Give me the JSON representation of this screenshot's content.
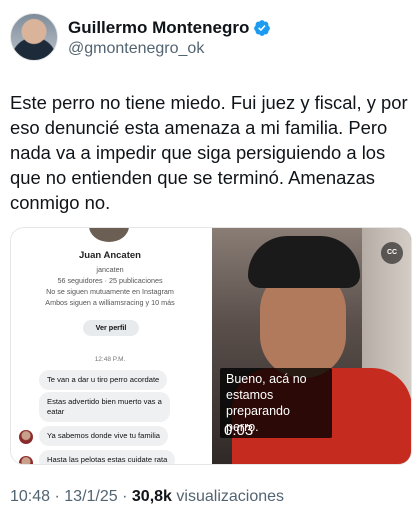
{
  "author": {
    "name": "Guillermo Montenegro",
    "handle": "@gmontenegro_ok",
    "verified_color": "#1d9bf0"
  },
  "tweet": {
    "text": "Este perro no tiene miedo. Fui juez y fiscal, y por eso denuncié esta amenaza a mi familia. Pero nada va a impedir que siga persiguiendo a los que no entienden que se terminó. Amenazas conmigo no."
  },
  "dm_screenshot": {
    "profile_name": "Juan Ancaten",
    "username": "jancaten",
    "stats": "56 seguidores · 25 publicaciones",
    "mutual_note": "No se siguen mutuamente en Instagram",
    "followers_note": "Ambos siguen a williamsracing y 10 más",
    "view_profile": "Ver perfil",
    "time": "12:48 P.M.",
    "messages": [
      "Te van a dar u  tiro perro acordate",
      "Estas advertido bien  muerto vas a\neatar",
      "Ya sabemos donde vive tu familia",
      "Hasta las pelotas estas cuidate rata"
    ]
  },
  "video": {
    "cc_label": "CC",
    "subtitle": "Bueno, acá no estamos preparando perro.",
    "duration": "0:03"
  },
  "footer": {
    "time": "10:48",
    "date": "13/1/25",
    "views_count": "30,8k",
    "views_label": "visualizaciones"
  }
}
